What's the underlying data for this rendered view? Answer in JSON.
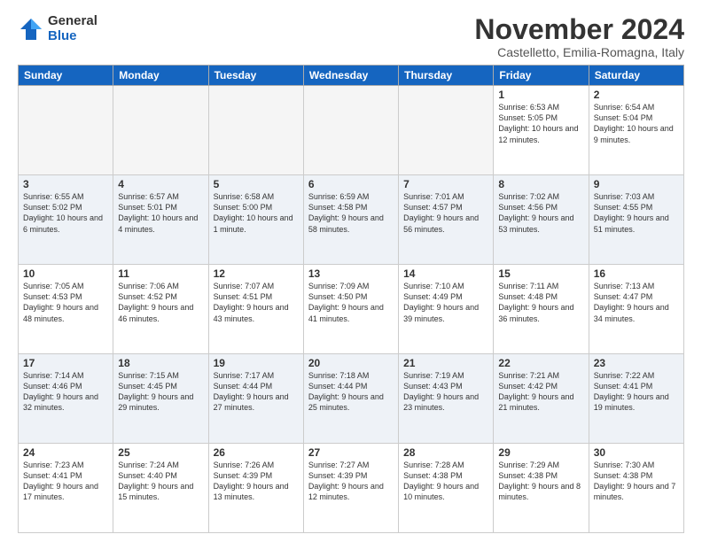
{
  "header": {
    "logo_general": "General",
    "logo_blue": "Blue",
    "month_title": "November 2024",
    "subtitle": "Castelletto, Emilia-Romagna, Italy"
  },
  "days_of_week": [
    "Sunday",
    "Monday",
    "Tuesday",
    "Wednesday",
    "Thursday",
    "Friday",
    "Saturday"
  ],
  "weeks": [
    [
      {
        "day": "",
        "info": ""
      },
      {
        "day": "",
        "info": ""
      },
      {
        "day": "",
        "info": ""
      },
      {
        "day": "",
        "info": ""
      },
      {
        "day": "",
        "info": ""
      },
      {
        "day": "1",
        "info": "Sunrise: 6:53 AM\nSunset: 5:05 PM\nDaylight: 10 hours and 12 minutes."
      },
      {
        "day": "2",
        "info": "Sunrise: 6:54 AM\nSunset: 5:04 PM\nDaylight: 10 hours and 9 minutes."
      }
    ],
    [
      {
        "day": "3",
        "info": "Sunrise: 6:55 AM\nSunset: 5:02 PM\nDaylight: 10 hours and 6 minutes."
      },
      {
        "day": "4",
        "info": "Sunrise: 6:57 AM\nSunset: 5:01 PM\nDaylight: 10 hours and 4 minutes."
      },
      {
        "day": "5",
        "info": "Sunrise: 6:58 AM\nSunset: 5:00 PM\nDaylight: 10 hours and 1 minute."
      },
      {
        "day": "6",
        "info": "Sunrise: 6:59 AM\nSunset: 4:58 PM\nDaylight: 9 hours and 58 minutes."
      },
      {
        "day": "7",
        "info": "Sunrise: 7:01 AM\nSunset: 4:57 PM\nDaylight: 9 hours and 56 minutes."
      },
      {
        "day": "8",
        "info": "Sunrise: 7:02 AM\nSunset: 4:56 PM\nDaylight: 9 hours and 53 minutes."
      },
      {
        "day": "9",
        "info": "Sunrise: 7:03 AM\nSunset: 4:55 PM\nDaylight: 9 hours and 51 minutes."
      }
    ],
    [
      {
        "day": "10",
        "info": "Sunrise: 7:05 AM\nSunset: 4:53 PM\nDaylight: 9 hours and 48 minutes."
      },
      {
        "day": "11",
        "info": "Sunrise: 7:06 AM\nSunset: 4:52 PM\nDaylight: 9 hours and 46 minutes."
      },
      {
        "day": "12",
        "info": "Sunrise: 7:07 AM\nSunset: 4:51 PM\nDaylight: 9 hours and 43 minutes."
      },
      {
        "day": "13",
        "info": "Sunrise: 7:09 AM\nSunset: 4:50 PM\nDaylight: 9 hours and 41 minutes."
      },
      {
        "day": "14",
        "info": "Sunrise: 7:10 AM\nSunset: 4:49 PM\nDaylight: 9 hours and 39 minutes."
      },
      {
        "day": "15",
        "info": "Sunrise: 7:11 AM\nSunset: 4:48 PM\nDaylight: 9 hours and 36 minutes."
      },
      {
        "day": "16",
        "info": "Sunrise: 7:13 AM\nSunset: 4:47 PM\nDaylight: 9 hours and 34 minutes."
      }
    ],
    [
      {
        "day": "17",
        "info": "Sunrise: 7:14 AM\nSunset: 4:46 PM\nDaylight: 9 hours and 32 minutes."
      },
      {
        "day": "18",
        "info": "Sunrise: 7:15 AM\nSunset: 4:45 PM\nDaylight: 9 hours and 29 minutes."
      },
      {
        "day": "19",
        "info": "Sunrise: 7:17 AM\nSunset: 4:44 PM\nDaylight: 9 hours and 27 minutes."
      },
      {
        "day": "20",
        "info": "Sunrise: 7:18 AM\nSunset: 4:44 PM\nDaylight: 9 hours and 25 minutes."
      },
      {
        "day": "21",
        "info": "Sunrise: 7:19 AM\nSunset: 4:43 PM\nDaylight: 9 hours and 23 minutes."
      },
      {
        "day": "22",
        "info": "Sunrise: 7:21 AM\nSunset: 4:42 PM\nDaylight: 9 hours and 21 minutes."
      },
      {
        "day": "23",
        "info": "Sunrise: 7:22 AM\nSunset: 4:41 PM\nDaylight: 9 hours and 19 minutes."
      }
    ],
    [
      {
        "day": "24",
        "info": "Sunrise: 7:23 AM\nSunset: 4:41 PM\nDaylight: 9 hours and 17 minutes."
      },
      {
        "day": "25",
        "info": "Sunrise: 7:24 AM\nSunset: 4:40 PM\nDaylight: 9 hours and 15 minutes."
      },
      {
        "day": "26",
        "info": "Sunrise: 7:26 AM\nSunset: 4:39 PM\nDaylight: 9 hours and 13 minutes."
      },
      {
        "day": "27",
        "info": "Sunrise: 7:27 AM\nSunset: 4:39 PM\nDaylight: 9 hours and 12 minutes."
      },
      {
        "day": "28",
        "info": "Sunrise: 7:28 AM\nSunset: 4:38 PM\nDaylight: 9 hours and 10 minutes."
      },
      {
        "day": "29",
        "info": "Sunrise: 7:29 AM\nSunset: 4:38 PM\nDaylight: 9 hours and 8 minutes."
      },
      {
        "day": "30",
        "info": "Sunrise: 7:30 AM\nSunset: 4:38 PM\nDaylight: 9 hours and 7 minutes."
      }
    ]
  ]
}
